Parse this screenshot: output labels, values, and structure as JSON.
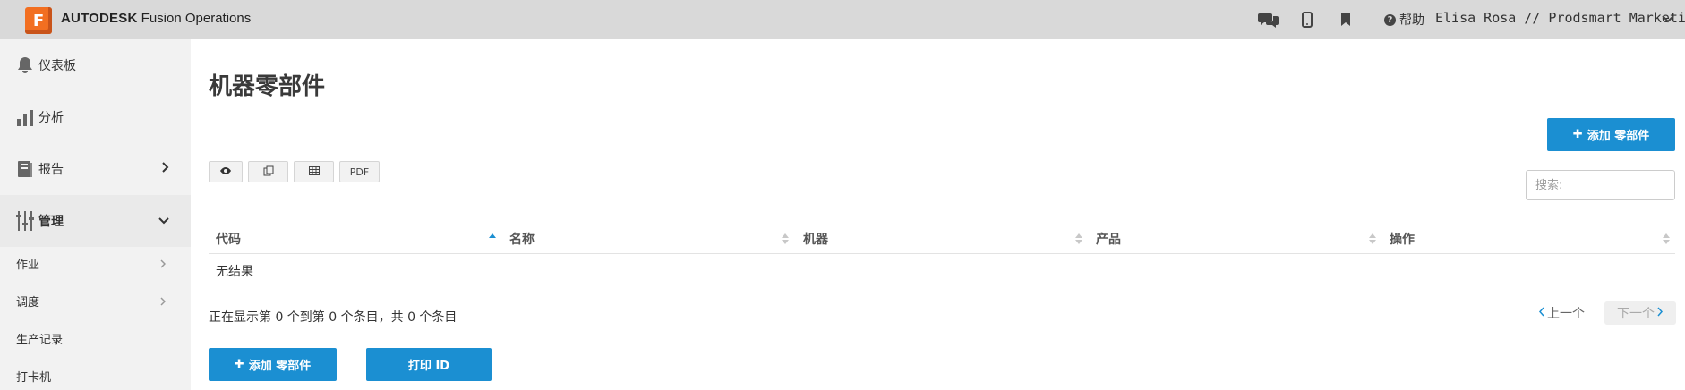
{
  "header": {
    "logo_letter": "F",
    "brand_bold": "AUTODESK",
    "brand_rest": " Fusion Operations",
    "help_label": "帮助",
    "user": "Elisa Rosa // Prodsmart Marketing",
    "icons": [
      "chat-icon",
      "mobile-icon",
      "bookmark-icon",
      "help-icon",
      "chevron-down-icon"
    ]
  },
  "sidebar": {
    "items": [
      {
        "label": "仪表板",
        "icon": "bell-icon"
      },
      {
        "label": "分析",
        "icon": "bar-chart-icon"
      },
      {
        "label": "报告",
        "icon": "book-icon"
      },
      {
        "label": "管理",
        "icon": "sliders-icon"
      }
    ],
    "sub_items": [
      {
        "label": "作业"
      },
      {
        "label": "调度"
      },
      {
        "label": "生产记录"
      },
      {
        "label": "打卡机"
      }
    ]
  },
  "main": {
    "title": "机器零部件",
    "add_label": "添加 零部件",
    "pdf_label": "PDF",
    "search_placeholder": "搜索:",
    "columns": [
      "代码",
      "名称",
      "机器",
      "产品",
      "操作"
    ],
    "empty_text": "无结果",
    "info_text": "正在显示第 0 个到第 0 个条目，共 0 个条目",
    "prev_label": "上一个",
    "next_label": "下一个",
    "print_label": "打印 ID"
  },
  "colors": {
    "accent": "#1b8fd2",
    "topbar": "#d9d9d9",
    "sidebar": "#f2f2f2",
    "logo": "#f26f21"
  }
}
